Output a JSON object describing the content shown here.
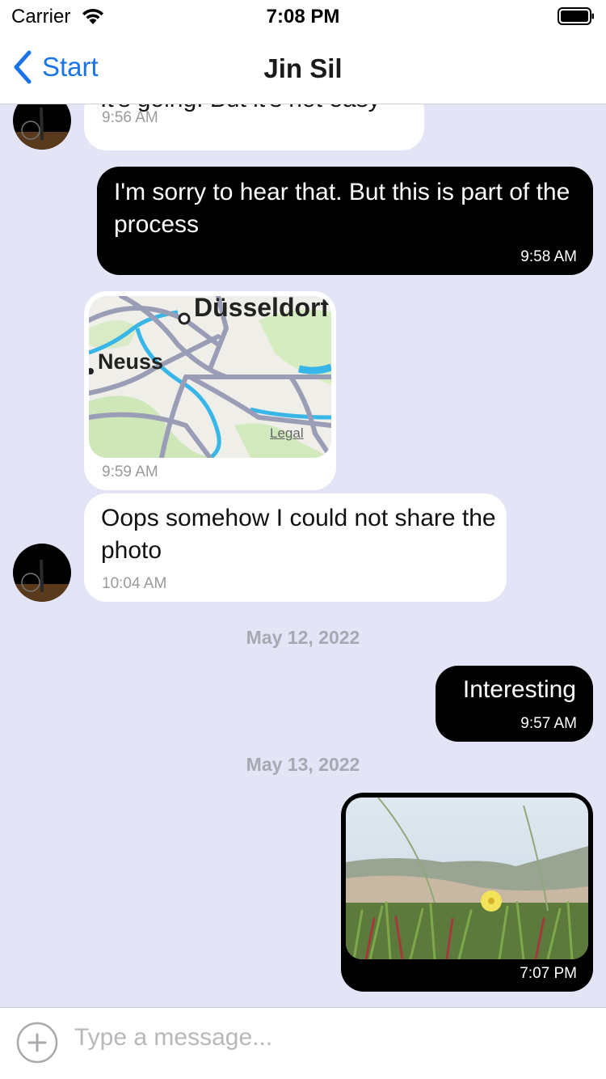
{
  "status_bar": {
    "carrier": "Carrier",
    "time": "7:08 PM",
    "wifi_icon": "wifi-icon",
    "battery_icon": "battery-full-icon"
  },
  "nav": {
    "back_label": "Start",
    "back_icon": "chevron-left-icon",
    "title": "Jin Sil",
    "accent_color": "#1a73e8"
  },
  "messages": [
    {
      "direction": "incoming",
      "type": "text",
      "text": "It's going. But it's not easy",
      "time": "9:56 AM"
    },
    {
      "direction": "outgoing",
      "type": "text",
      "text": "I'm sorry to hear that. But this is part of the process",
      "time": "9:58 AM"
    },
    {
      "direction": "incoming",
      "type": "location",
      "map_labels": [
        "Düsseldorf",
        "Neuss"
      ],
      "map_legal": "Legal",
      "time": "9:59 AM"
    },
    {
      "direction": "incoming",
      "type": "text",
      "text": "Oops somehow I could not share the photo",
      "time": "10:04 AM"
    },
    {
      "direction": "outgoing",
      "type": "text",
      "text": "Interesting",
      "time": "9:57 AM"
    },
    {
      "direction": "outgoing",
      "type": "image",
      "image_description": "dune-grass-with-yellow-flower-photo",
      "time": "7:07 PM"
    }
  ],
  "date_separators": [
    "May 12, 2022",
    "May 13, 2022"
  ],
  "input": {
    "placeholder": "Type a message...",
    "add_icon": "plus-circle-icon"
  },
  "colors": {
    "chat_background": "#e4e4f7",
    "incoming_bubble": "#ffffff",
    "outgoing_bubble": "#000000"
  }
}
